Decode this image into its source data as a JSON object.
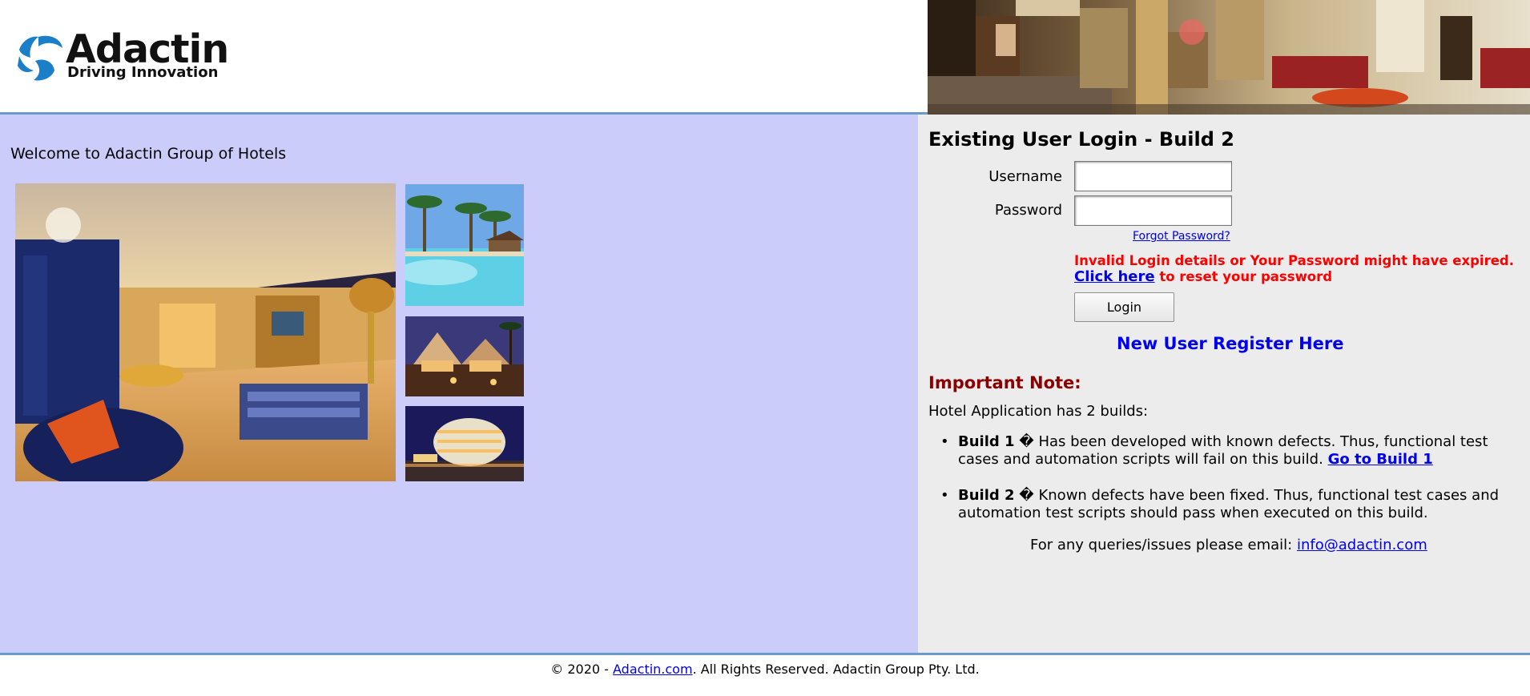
{
  "header": {
    "logo_word": "Adactin",
    "logo_tagline": "Driving Innovation"
  },
  "left": {
    "welcome": "Welcome to Adactin Group of Hotels"
  },
  "login": {
    "title": "Existing User Login - Build 2",
    "username_label": "Username",
    "password_label": "Password",
    "username_value": "",
    "password_value": "",
    "forgot_link": "Forgot Password?",
    "error_line1": "Invalid Login details or Your Password might have expired.",
    "error_link": "Click here",
    "error_line2_rest": " to reset your password",
    "login_button": "Login",
    "register_link": "New User Register Here"
  },
  "note": {
    "title": "Important Note:",
    "intro": "Hotel Application has 2 builds:",
    "build1_label": "Build 1",
    "build1_text": " � Has been developed with known defects. Thus, functional test cases and automation scripts will fail on this build. ",
    "build1_link": "Go to Build 1",
    "build2_label": "Build 2",
    "build2_text": " � Known defects have been fixed. Thus, functional test cases and automation test scripts should pass when executed on this build.",
    "contact_prefix": "For any queries/issues please email: ",
    "contact_email": "info@adactin.com"
  },
  "footer": {
    "prefix": "© 2020 - ",
    "link": "Adactin.com",
    "suffix": ". All Rights Reserved. Adactin Group Pty. Ltd."
  },
  "colors": {
    "left_bg": "#ccccfb",
    "right_bg": "#ececec",
    "error_red": "#ff0000",
    "link_blue": "#0000ee",
    "note_red": "#8b0000",
    "rule_blue": "#6a9bc8",
    "logo_blue": "#1a7fc8"
  }
}
